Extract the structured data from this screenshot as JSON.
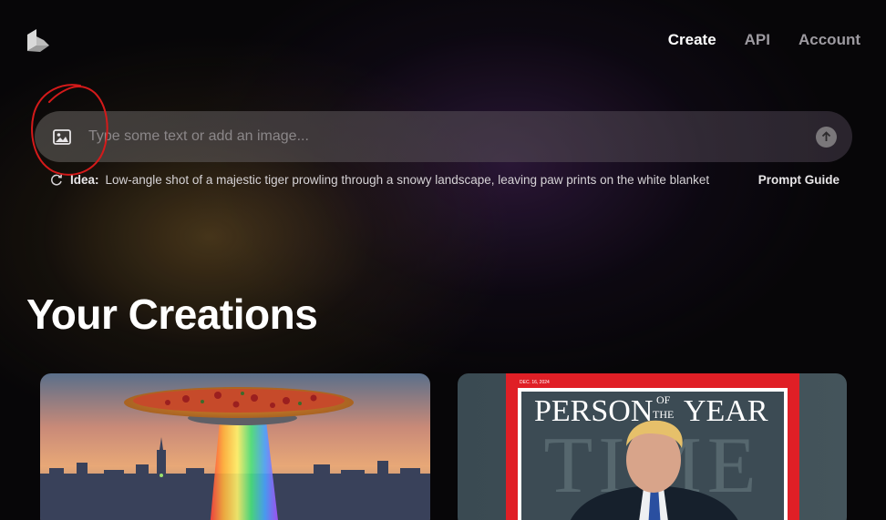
{
  "header": {
    "logo_icon": "cube-logo-icon",
    "nav": [
      {
        "label": "Create",
        "active": true
      },
      {
        "label": "API",
        "active": false
      },
      {
        "label": "Account",
        "active": false
      }
    ]
  },
  "prompt": {
    "image_button_icon": "image-icon",
    "placeholder": "Type some text or add an image...",
    "value": "",
    "submit_icon": "arrow-up-icon"
  },
  "idea": {
    "refresh_icon": "refresh-icon",
    "label": "Idea:",
    "text": "Low-angle shot of a majestic tiger prowling through a snowy landscape, leaving paw prints on the white blanket",
    "guide_label": "Prompt Guide"
  },
  "creations": {
    "title": "Your Creations",
    "items": [
      {
        "description": "pizza UFO over city skyline"
      },
      {
        "description": "magazine cover",
        "cover_heading_1": "PERSON",
        "cover_heading_2": "YEAR",
        "cover_of_the_1": "OF",
        "cover_of_the_2": "THE",
        "cover_masthead": "TIME",
        "cover_date": "DEC. 16, 2024"
      }
    ]
  },
  "colors": {
    "annotation": "#d41a1a",
    "cover_border": "#e01f26",
    "active_nav": "#ffffff",
    "inactive_nav": "#9d9aa0"
  }
}
